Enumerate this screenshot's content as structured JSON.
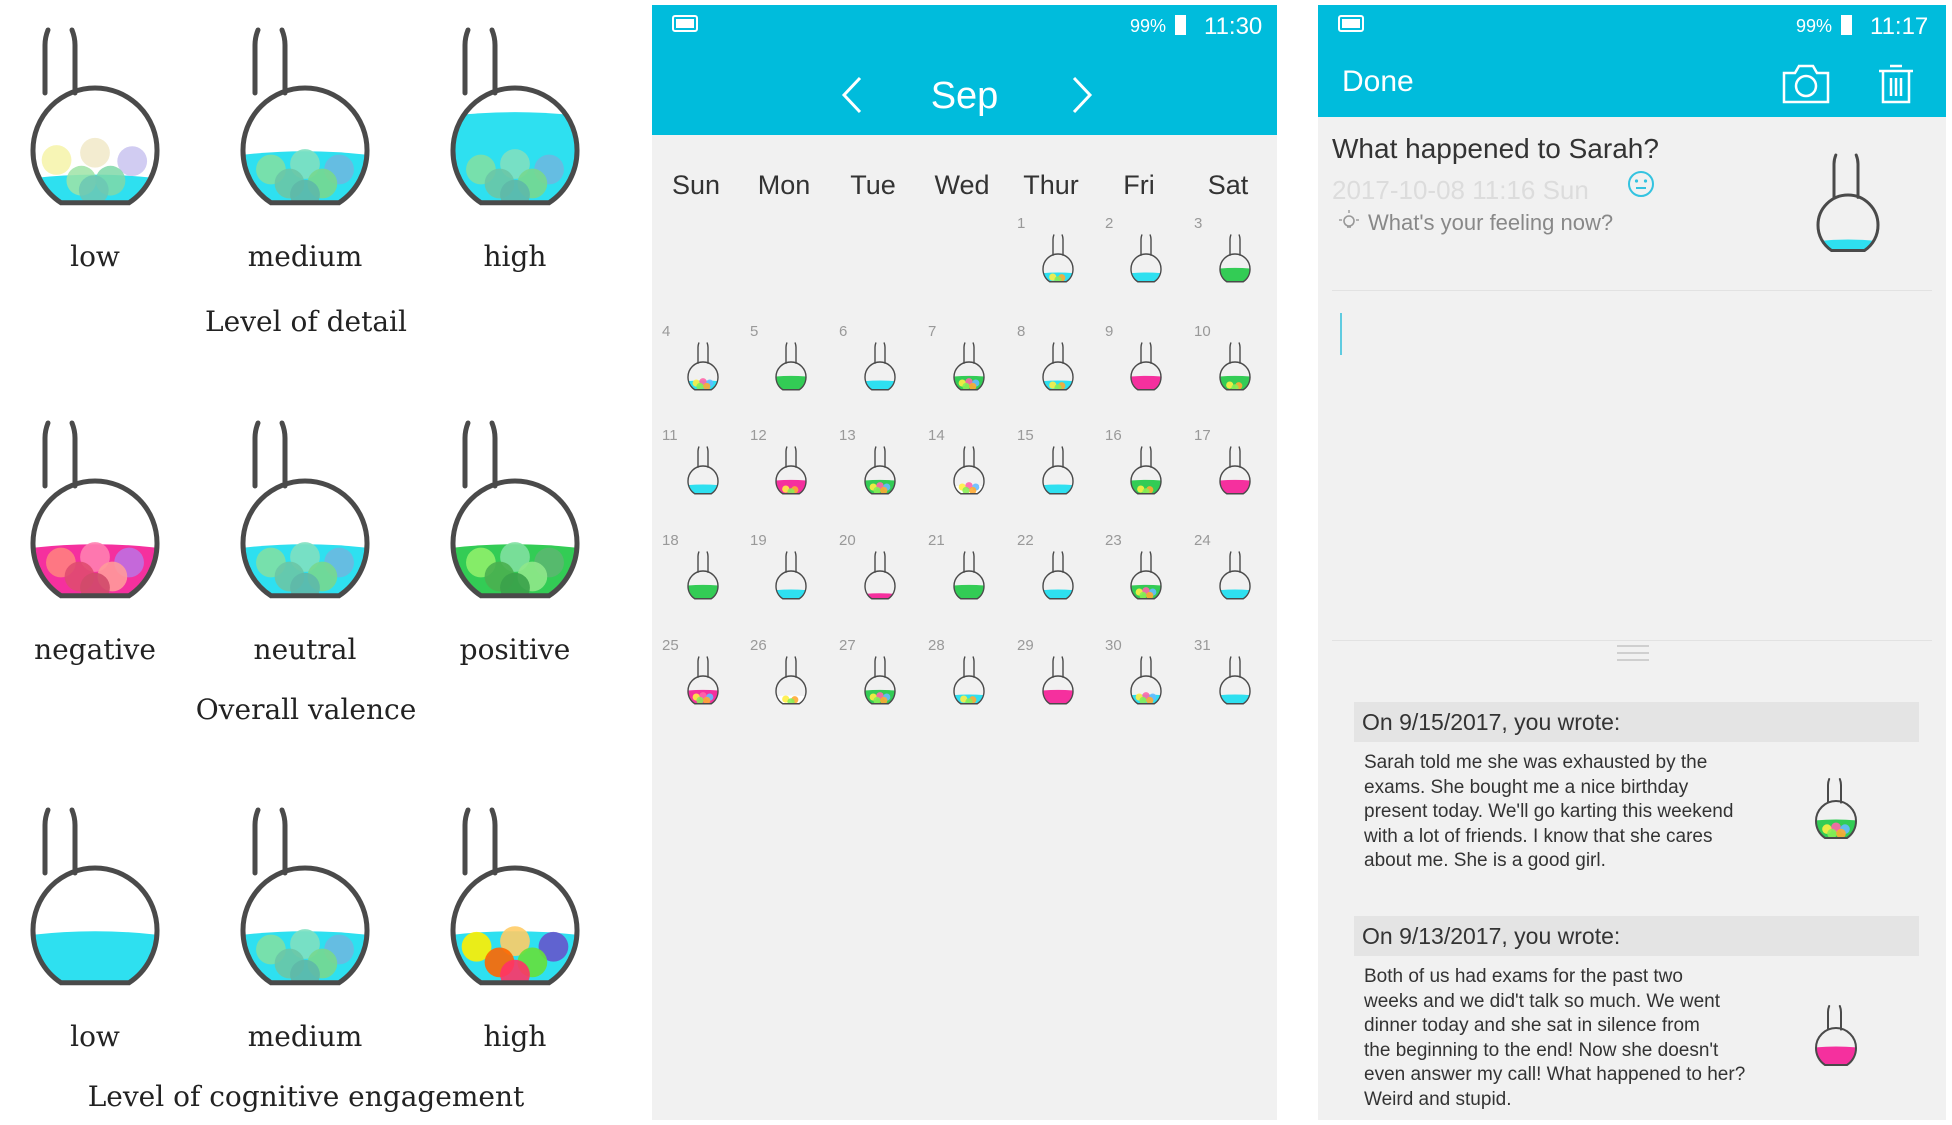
{
  "legend": {
    "detail": {
      "title": "Level of detail",
      "labels": [
        "low",
        "medium",
        "high"
      ]
    },
    "valence": {
      "title": "Overall valence",
      "labels": [
        "negative",
        "neutral",
        "positive"
      ]
    },
    "engagement": {
      "title": "Level of cognitive engagement",
      "labels": [
        "low",
        "medium",
        "high"
      ]
    }
  },
  "calendar_screen": {
    "status": {
      "battery": "99%",
      "time": "11:30"
    },
    "month": "Sep",
    "prev_label": "<",
    "next_label": ">",
    "weekdays": [
      "Sun",
      "Mon",
      "Tue",
      "Wed",
      "Thur",
      "Fri",
      "Sat"
    ],
    "days": [
      {
        "n": "1",
        "liquid": "cyan",
        "balls": "few"
      },
      {
        "n": "2",
        "liquid": "cyan",
        "balls": "none"
      },
      {
        "n": "3",
        "liquid": "green",
        "balls": "none"
      },
      {
        "n": "4",
        "liquid": "cyan",
        "balls": "many"
      },
      {
        "n": "5",
        "liquid": "green",
        "balls": "none"
      },
      {
        "n": "6",
        "liquid": "cyan",
        "balls": "none"
      },
      {
        "n": "7",
        "liquid": "green",
        "balls": "many"
      },
      {
        "n": "8",
        "liquid": "cyan",
        "balls": "few"
      },
      {
        "n": "9",
        "liquid": "pink",
        "balls": "none"
      },
      {
        "n": "10",
        "liquid": "green",
        "balls": "few"
      },
      {
        "n": "11",
        "liquid": "cyan",
        "balls": "none"
      },
      {
        "n": "12",
        "liquid": "pink",
        "balls": "few"
      },
      {
        "n": "13",
        "liquid": "green",
        "balls": "many"
      },
      {
        "n": "14",
        "liquid": "white",
        "balls": "many"
      },
      {
        "n": "15",
        "liquid": "cyan",
        "balls": "none"
      },
      {
        "n": "16",
        "liquid": "green",
        "balls": "few"
      },
      {
        "n": "17",
        "liquid": "pink",
        "balls": "none"
      },
      {
        "n": "18",
        "liquid": "green",
        "balls": "none"
      },
      {
        "n": "19",
        "liquid": "cyan",
        "balls": "none"
      },
      {
        "n": "20",
        "liquid": "pink",
        "balls": "none"
      },
      {
        "n": "21",
        "liquid": "green",
        "balls": "none"
      },
      {
        "n": "22",
        "liquid": "cyan",
        "balls": "none"
      },
      {
        "n": "23",
        "liquid": "green",
        "balls": "many"
      },
      {
        "n": "24",
        "liquid": "cyan",
        "balls": "none"
      },
      {
        "n": "25",
        "liquid": "pink",
        "balls": "many"
      },
      {
        "n": "26",
        "liquid": "white",
        "balls": "few"
      },
      {
        "n": "27",
        "liquid": "green",
        "balls": "many"
      },
      {
        "n": "28",
        "liquid": "cyan",
        "balls": "few"
      },
      {
        "n": "29",
        "liquid": "pink",
        "balls": "none"
      },
      {
        "n": "30",
        "liquid": "cyan",
        "balls": "many"
      },
      {
        "n": "31",
        "liquid": "cyan",
        "balls": "none"
      }
    ]
  },
  "entry_screen": {
    "status": {
      "battery": "99%",
      "time": "11:17"
    },
    "done_label": "Done",
    "camera_icon": "camera-icon",
    "trash_icon": "trash-icon",
    "question": "What happened to Sarah?",
    "date": "2017-10-08 11:16  Sun",
    "feeling_prompt": "What's your feeling now?",
    "past_entries": [
      {
        "heading": "On 9/15/2017, you wrote:",
        "lines": [
          "Sarah told me she was exhausted by the",
          "exams. She bought me a nice birthday",
          "present today. We'll go karting this weekend",
          "with a lot of friends. I know that she cares",
          "about me. She is a good girl."
        ],
        "liquid": "green"
      },
      {
        "heading": "On 9/13/2017, you wrote:",
        "lines": [
          "Both of us had exams for the past two",
          "weeks and we did't talk so much. We went",
          "dinner today and she sat in silence from",
          "the beginning to the end! Now she doesn't",
          "even answer my call! What happened to her?",
          "Weird and stupid."
        ],
        "liquid": "pink"
      }
    ]
  },
  "colors": {
    "accent": "#00bcdc",
    "cyan": "#2ee0f0",
    "pink": "#f5309e",
    "green": "#33cc55",
    "flask_outline": "#4a4a4a"
  }
}
